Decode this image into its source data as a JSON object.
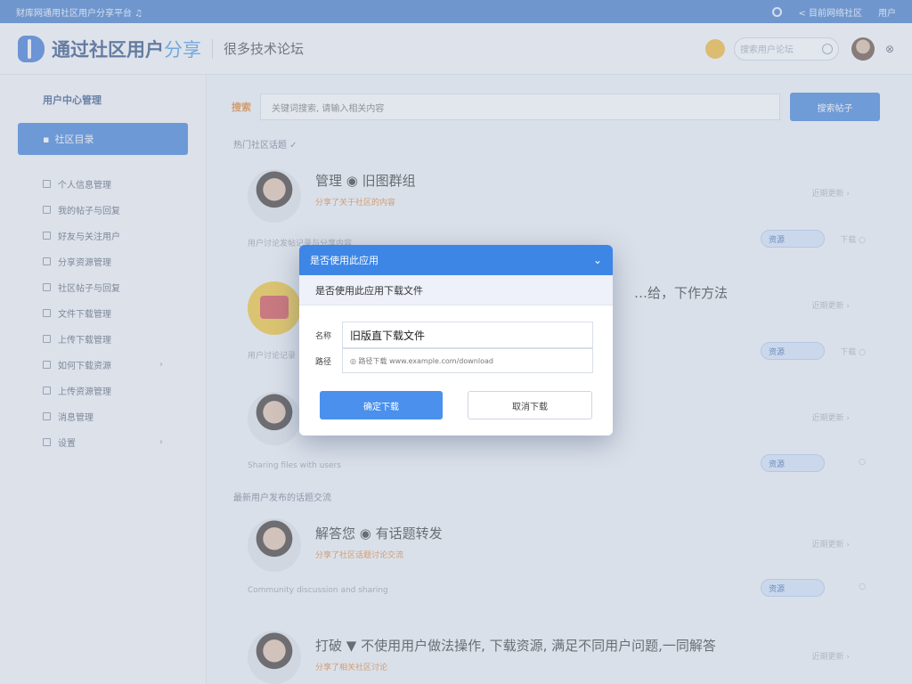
{
  "topbar": {
    "left_text": "财库网通用社区用户分享平台 ♫",
    "right_text": "< 目前网络社区",
    "user": "用户"
  },
  "header": {
    "brand": "通过社区用户",
    "brand_accent": "分享",
    "subtitle": "很多技术论坛",
    "search_placeholder": "搜索用户论坛"
  },
  "sidebar": {
    "head": "用户中心管理",
    "active": "社区目录",
    "items": [
      {
        "label": "个人信息管理"
      },
      {
        "label": "我的帖子与回复"
      },
      {
        "label": "好友与关注用户"
      },
      {
        "label": "分享资源管理"
      },
      {
        "label": "社区帖子与回复"
      },
      {
        "label": "文件下载管理"
      },
      {
        "label": "上传下载管理"
      },
      {
        "label": "如何下载资源",
        "chevron": "›"
      },
      {
        "label": "上传资源管理"
      },
      {
        "label": "消息管理"
      },
      {
        "label": "设置",
        "chevron": "›"
      }
    ]
  },
  "main": {
    "filter_label": "搜索",
    "filter_value": "关键词搜索, 请输入相关内容",
    "search_button": "搜索帖子",
    "section1": "热门社区话题 ✓",
    "section2": "最新用户发布的话题交流",
    "cards": [
      {
        "title": "管理 ◉   旧图群组",
        "meta": "分享了关于社区的内容",
        "date": "近期更新 ›",
        "foot": "用户讨论发帖记录与分享内容",
        "tag": "资源",
        "ctl": "下载 ○"
      },
      {
        "title": "…给，下作方法",
        "meta": "",
        "date": "近期更新 ›",
        "foot": "用户讨论记录",
        "tag": "资源",
        "ctl": "下载 ○"
      },
      {
        "title": "",
        "meta": "",
        "date": "近期更新 ›",
        "foot": "Sharing files with users",
        "tag": "资源",
        "ctl": "○"
      },
      {
        "title": "解答您 ◉   有话题转发",
        "meta": "分享了社区话题讨论交流",
        "date": "近期更新 ›",
        "foot": "Community discussion and sharing",
        "tag": "资源",
        "ctl": "○"
      },
      {
        "title": "打破 ▼ 不使用用户做法操作, 下载资源, 满足不同用户问题,一同解答",
        "meta": "分享了相关社区讨论",
        "date": "近期更新 ›",
        "foot": "",
        "tag": "",
        "ctl": ""
      }
    ]
  },
  "dialog": {
    "title": "是否使用此应用",
    "subtitle": "是否使用此应用下载文件",
    "name_label": "名称",
    "name_value": "旧版直下载文件",
    "path_label": "路径",
    "path_value": "◎ 路径下载 www.example.com/download",
    "ok": "确定下载",
    "cancel": "取消下载",
    "close": "⌄"
  }
}
